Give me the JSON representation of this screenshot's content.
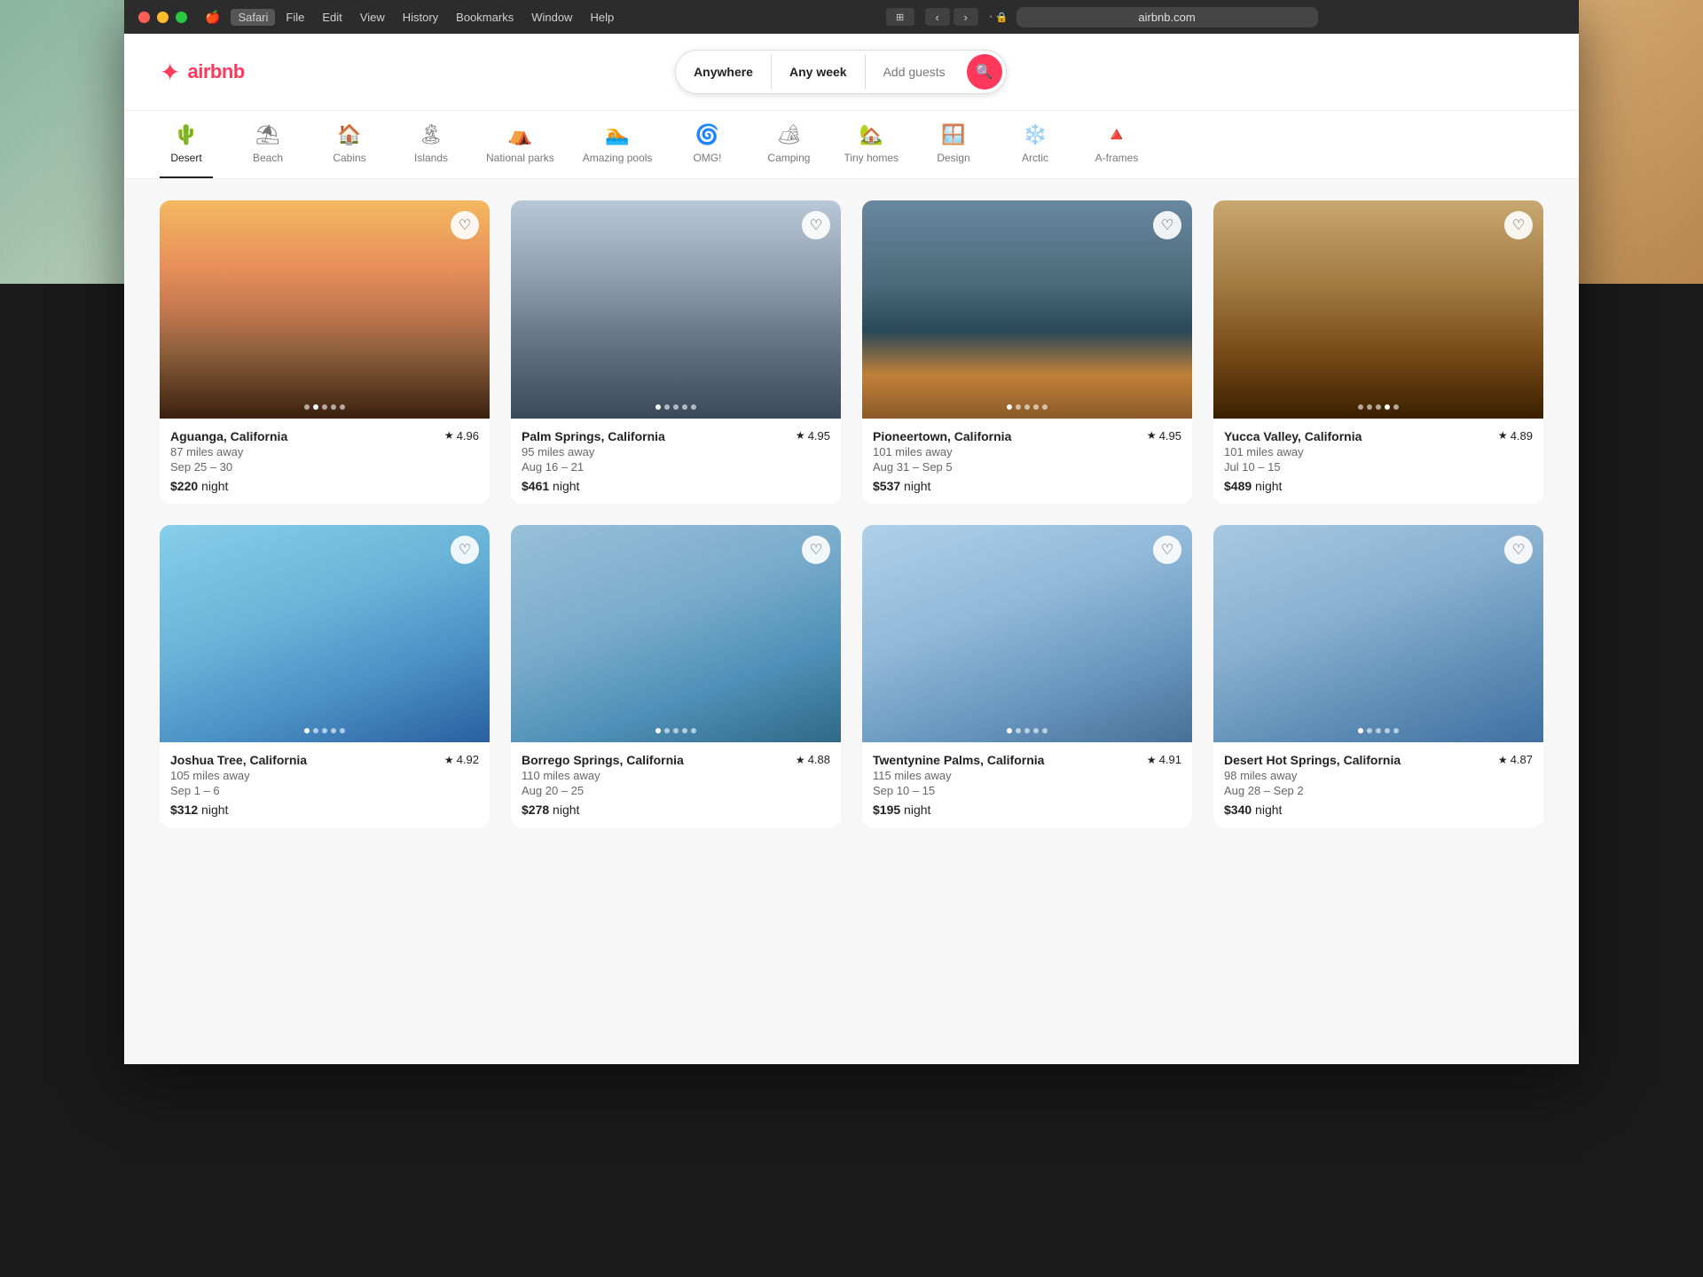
{
  "browser": {
    "title": "airbnb.com",
    "menu_items": [
      "Safari",
      "File",
      "Edit",
      "View",
      "History",
      "Bookmarks",
      "Window",
      "Help"
    ],
    "url": "airbnb.com",
    "back_btn": "‹",
    "forward_btn": "›"
  },
  "header": {
    "logo_text": "airbnb",
    "logo_icon": "✦",
    "search": {
      "anywhere_label": "Anywhere",
      "anyweek_label": "Any week",
      "guests_label": "Add guests",
      "search_icon": "🔍"
    }
  },
  "categories": [
    {
      "id": "desert",
      "label": "Desert",
      "icon": "🌵",
      "active": true
    },
    {
      "id": "beach",
      "label": "Beach",
      "icon": "⛱"
    },
    {
      "id": "cabins",
      "label": "Cabins",
      "icon": "🏠"
    },
    {
      "id": "islands",
      "label": "Islands",
      "icon": "🏝"
    },
    {
      "id": "national-parks",
      "label": "National parks",
      "icon": "⛺"
    },
    {
      "id": "amazing-pools",
      "label": "Amazing pools",
      "icon": "🏊"
    },
    {
      "id": "omg",
      "label": "OMG!",
      "icon": "🌀"
    },
    {
      "id": "camping",
      "label": "Camping",
      "icon": "⛺"
    },
    {
      "id": "tiny-homes",
      "label": "Tiny homes",
      "icon": "🏡"
    },
    {
      "id": "design",
      "label": "Design",
      "icon": "🪟"
    },
    {
      "id": "arctic",
      "label": "Arctic",
      "icon": "❄"
    },
    {
      "id": "a-frames",
      "label": "A-frames",
      "icon": "🔺"
    }
  ],
  "listings": [
    {
      "id": 1,
      "location": "Aguanga, California",
      "rating": "4.96",
      "distance": "87 miles away",
      "dates": "Sep 25 – 30",
      "price": "$220",
      "price_unit": "night",
      "img_class": "img-cabin",
      "dots": 5,
      "active_dot": 2
    },
    {
      "id": 2,
      "location": "Palm Springs, California",
      "rating": "4.95",
      "distance": "95 miles away",
      "dates": "Aug 16 – 21",
      "price": "$461",
      "price_unit": "night",
      "img_class": "img-glass-house",
      "dots": 5,
      "active_dot": 1
    },
    {
      "id": 3,
      "location": "Pioneertown, California",
      "rating": "4.95",
      "distance": "101 miles away",
      "dates": "Aug 31 – Sep 5",
      "price": "$537",
      "price_unit": "night",
      "img_class": "img-modern",
      "dots": 5,
      "active_dot": 1
    },
    {
      "id": 4,
      "location": "Yucca Valley, California",
      "rating": "4.89",
      "distance": "101 miles away",
      "dates": "Jul 10 – 15",
      "price": "$489",
      "price_unit": "night",
      "img_class": "img-valley",
      "dots": 5,
      "active_dot": 4
    },
    {
      "id": 5,
      "location": "Joshua Tree, California",
      "rating": "4.92",
      "distance": "105 miles away",
      "dates": "Sep 1 – 6",
      "price": "$312",
      "price_unit": "night",
      "img_class": "img-sky1",
      "dots": 5,
      "active_dot": 1
    },
    {
      "id": 6,
      "location": "Borrego Springs, California",
      "rating": "4.88",
      "distance": "110 miles away",
      "dates": "Aug 20 – 25",
      "price": "$278",
      "price_unit": "night",
      "img_class": "img-sky2",
      "dots": 5,
      "active_dot": 1
    },
    {
      "id": 7,
      "location": "Twentynine Palms, California",
      "rating": "4.91",
      "distance": "115 miles away",
      "dates": "Sep 10 – 15",
      "price": "$195",
      "price_unit": "night",
      "img_class": "img-sky3",
      "dots": 5,
      "active_dot": 1
    },
    {
      "id": 8,
      "location": "Desert Hot Springs, California",
      "rating": "4.87",
      "distance": "98 miles away",
      "dates": "Aug 28 – Sep 2",
      "price": "$340",
      "price_unit": "night",
      "img_class": "img-sky4",
      "dots": 5,
      "active_dot": 1
    }
  ]
}
